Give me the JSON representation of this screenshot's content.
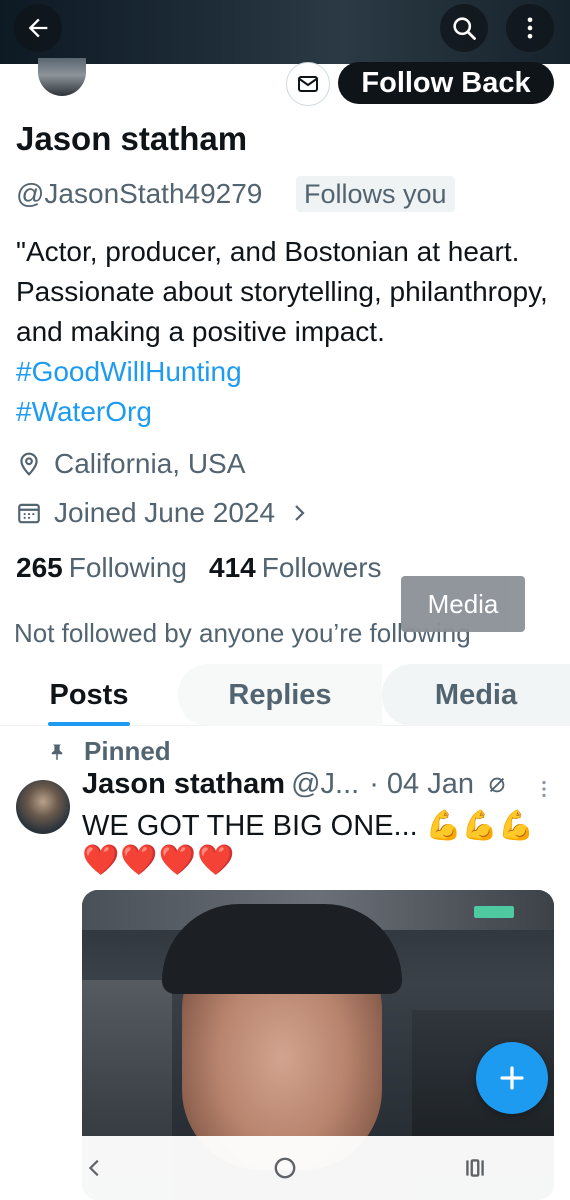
{
  "header": {
    "back_icon": "arrow-left-icon",
    "search_icon": "search-icon",
    "more_icon": "more-vertical-icon"
  },
  "profile": {
    "name": "Jason statham",
    "handle": "@JasonStath49279",
    "follows_you": "Follows you",
    "follow_button": "Follow Back",
    "message_icon": "envelope-icon",
    "bio_text": "\"Actor, producer, and Bostonian at heart. Passionate about storytelling, philanthropy, and making a positive impact. ",
    "bio_hashtag_1": "#GoodWillHunting",
    "bio_hashtag_2": "#WaterOrg",
    "location": "California, USA",
    "joined": "Joined June 2024",
    "following_count": "265",
    "following_label": "Following",
    "followers_count": "414",
    "followers_label": "Followers",
    "not_followed": "Not followed by anyone you’re following"
  },
  "tooltip": "Media",
  "tabs": [
    {
      "label": "Posts",
      "selected": true
    },
    {
      "label": "Replies",
      "selected": false
    },
    {
      "label": "Media",
      "selected": false
    }
  ],
  "post": {
    "pinned_label": "Pinned",
    "author": "Jason statham",
    "handle": "@J...",
    "date": "· 04 Jan",
    "text": "WE GOT THE BIG ONE... 💪💪💪",
    "hearts": "❤️❤️❤️❤️"
  },
  "fab_icon": "plus-icon",
  "nav": {
    "back": "nav-back-icon",
    "home": "nav-home-icon",
    "recents": "nav-recents-icon"
  },
  "colors": {
    "accent": "#1d9bf0",
    "text": "#0f1419",
    "secondary": "#536471"
  }
}
